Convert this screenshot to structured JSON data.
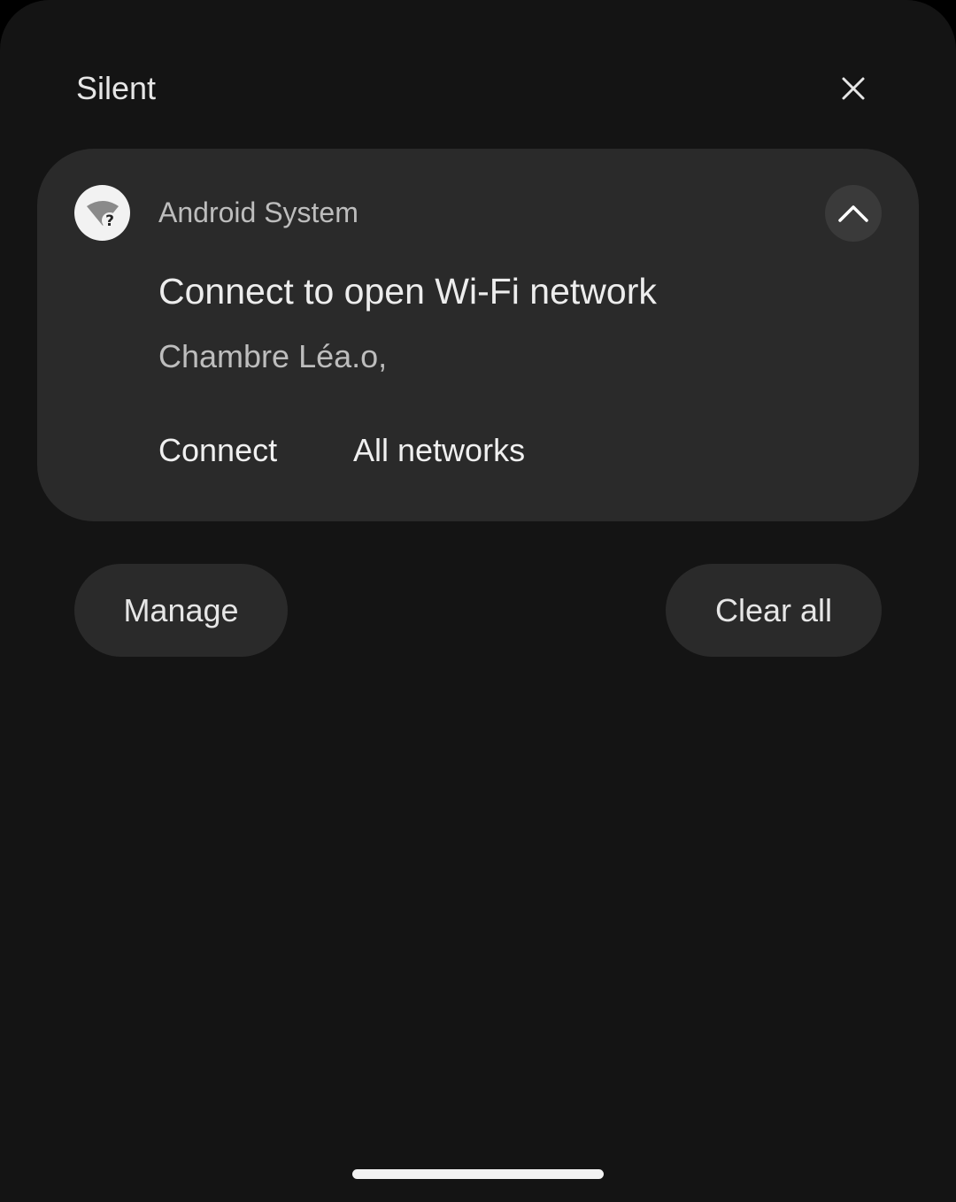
{
  "section": {
    "title": "Silent"
  },
  "notification": {
    "app_name": "Android System",
    "app_icon": "wifi-question-icon",
    "title": "Connect to open Wi-Fi network",
    "text": "Chambre Léa.o,",
    "actions": [
      {
        "label": "Connect"
      },
      {
        "label": "All networks"
      }
    ]
  },
  "footer": {
    "manage_label": "Manage",
    "clear_all_label": "Clear all"
  },
  "colors": {
    "background": "#141414",
    "card": "#2a2a2a",
    "text_primary": "#ededed",
    "text_secondary": "#bdbdbd"
  }
}
